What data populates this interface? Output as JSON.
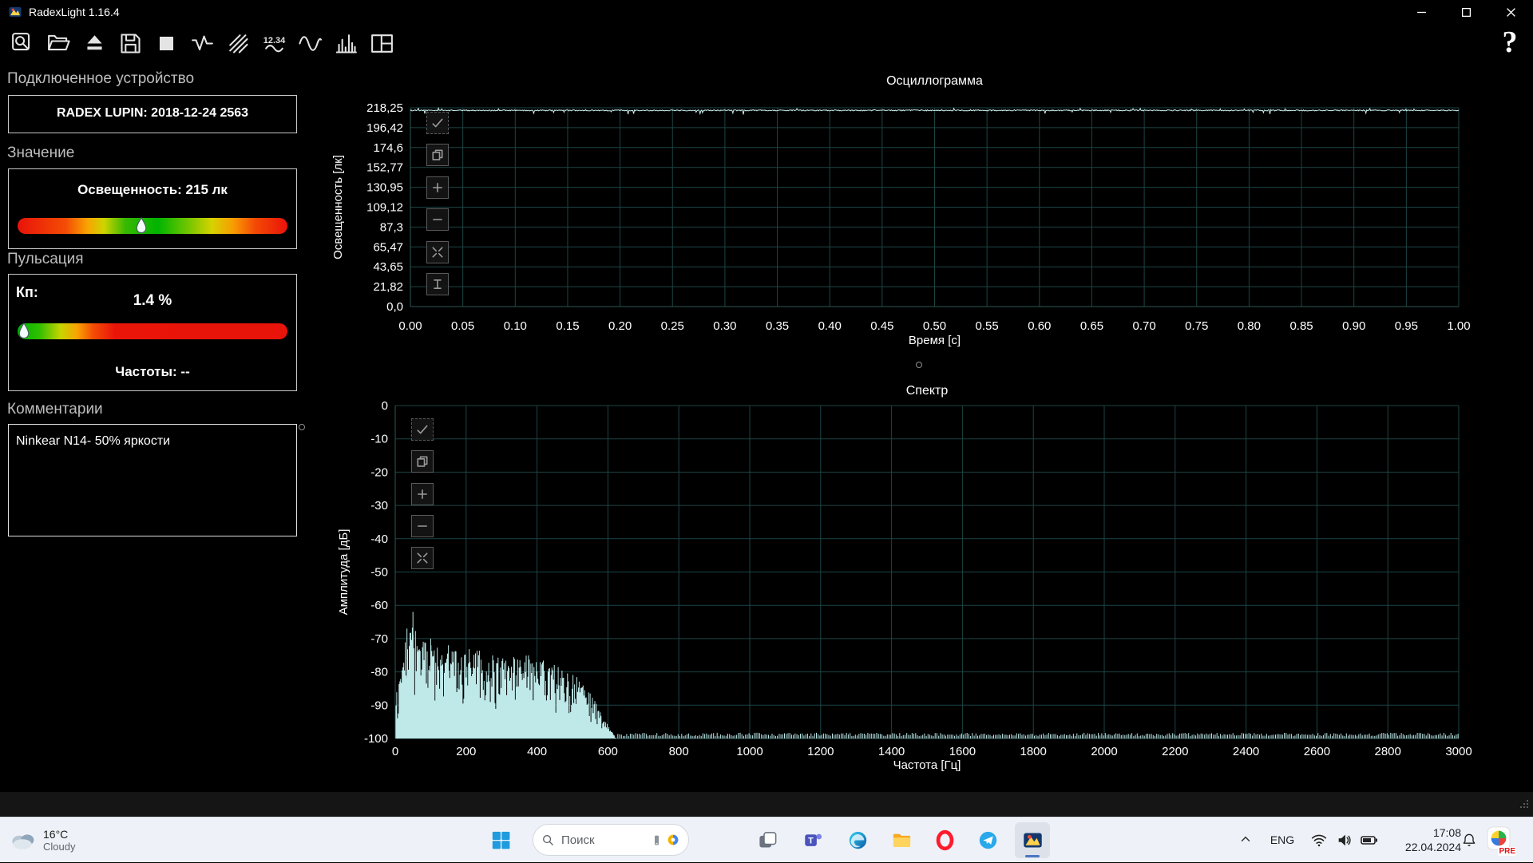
{
  "window": {
    "title": "RadexLight 1.16.4"
  },
  "toolbar": {
    "help_label": "?",
    "buttons": [
      {
        "name": "preview"
      },
      {
        "name": "open-file"
      },
      {
        "name": "eject-device"
      },
      {
        "name": "save-file"
      },
      {
        "name": "stop-measurement"
      },
      {
        "name": "pulse-mode"
      },
      {
        "name": "multi-chart-mode"
      },
      {
        "name": "numeric-mode"
      },
      {
        "name": "oscillogram-mode"
      },
      {
        "name": "spectrum-mode"
      },
      {
        "name": "layout-mode"
      }
    ]
  },
  "sidebar": {
    "device": {
      "section_title": "Подключенное устройство",
      "name": "RADEX LUPIN: 2018-12-24 2563"
    },
    "value": {
      "section_title": "Значение",
      "illuminance": "Освещенность: 215 лк",
      "marker_position_pct": 46
    },
    "pulsation": {
      "section_title": "Пульсация",
      "coefficient_label": "Кп:",
      "coefficient_value": "1.4 %",
      "frequencies": "Частоты: --",
      "marker_position_pct": 2.5
    },
    "comments": {
      "section_title": "Комментарии",
      "text": "Ninkear N14- 50% яркости"
    }
  },
  "charts_ui": {
    "oscillogram_buttons": [
      "autoscale",
      "copy",
      "zoom-in",
      "zoom-out",
      "fit",
      "cursor"
    ],
    "spectrum_buttons": [
      "autoscale",
      "copy",
      "zoom-in",
      "zoom-out",
      "fit"
    ]
  },
  "chart_data": [
    {
      "type": "line",
      "title": "Осциллограмма",
      "xlabel": "Время [с]",
      "ylabel": "Освещенность [лк]",
      "x_ticks": [
        "0.00",
        "0.05",
        "0.10",
        "0.15",
        "0.20",
        "0.25",
        "0.30",
        "0.35",
        "0.40",
        "0.45",
        "0.50",
        "0.55",
        "0.60",
        "0.65",
        "0.70",
        "0.75",
        "0.80",
        "0.85",
        "0.90",
        "0.95",
        "1.00"
      ],
      "y_ticks": [
        "218,25",
        "196,42",
        "174,6",
        "152,77",
        "130,95",
        "109,12",
        "87,3",
        "65,47",
        "43,65",
        "21,82",
        "0,0"
      ],
      "xlim": [
        0,
        1
      ],
      "ylim": [
        0,
        218.25
      ],
      "grid": true,
      "line_color": "#cdeeee",
      "series": [
        {
          "name": "illuminance",
          "description": "near-constant illuminance around 215 lx with small noise spikes",
          "baseline": 215.4,
          "noise_amplitude": 1.2,
          "spike_amplitude": 3.5
        }
      ]
    },
    {
      "type": "bar",
      "title": "Спектр",
      "xlabel": "Частота [Гц]",
      "ylabel": "Амплитуда [дБ]",
      "x_ticks": [
        "0",
        "200",
        "400",
        "600",
        "800",
        "1000",
        "1200",
        "1400",
        "1600",
        "1800",
        "2000",
        "2200",
        "2400",
        "2600",
        "2800",
        "3000"
      ],
      "y_ticks": [
        "0",
        "-10",
        "-20",
        "-30",
        "-40",
        "-50",
        "-60",
        "-70",
        "-80",
        "-90",
        "-100"
      ],
      "xlim": [
        0,
        3000
      ],
      "ylim": [
        -100,
        0
      ],
      "grid": true,
      "line_color": "#bfe9e9",
      "envelope_points": [
        [
          0,
          -86
        ],
        [
          15,
          -74
        ],
        [
          40,
          -68
        ],
        [
          50,
          -62
        ],
        [
          60,
          -70
        ],
        [
          100,
          -72
        ],
        [
          150,
          -74
        ],
        [
          220,
          -73
        ],
        [
          300,
          -76
        ],
        [
          380,
          -75
        ],
        [
          450,
          -78
        ],
        [
          520,
          -82
        ],
        [
          560,
          -88
        ],
        [
          600,
          -96
        ],
        [
          624,
          -100
        ],
        [
          3000,
          -99
        ]
      ],
      "peaks": [
        {
          "hz": 33,
          "db": -67
        },
        {
          "hz": 50,
          "db": -62
        },
        {
          "hz": 100,
          "db": -70
        },
        {
          "hz": 150,
          "db": -72
        }
      ],
      "noise_band_hz": [
        0,
        624
      ],
      "noise_floor_db": -100
    }
  ],
  "taskbar": {
    "weather": {
      "temperature": "16°C",
      "condition": "Cloudy"
    },
    "search": {
      "placeholder": "Поиск"
    },
    "apps": [
      {
        "name": "start"
      },
      {
        "name": "task-view"
      },
      {
        "name": "teams"
      },
      {
        "name": "edge"
      },
      {
        "name": "file-explorer"
      },
      {
        "name": "opera"
      },
      {
        "name": "messenger"
      },
      {
        "name": "radexlight",
        "active": true
      }
    ],
    "tray": {
      "language": "ENG",
      "time": "17:08",
      "date": "22.04.2024",
      "recording_badge": "PRE"
    }
  }
}
